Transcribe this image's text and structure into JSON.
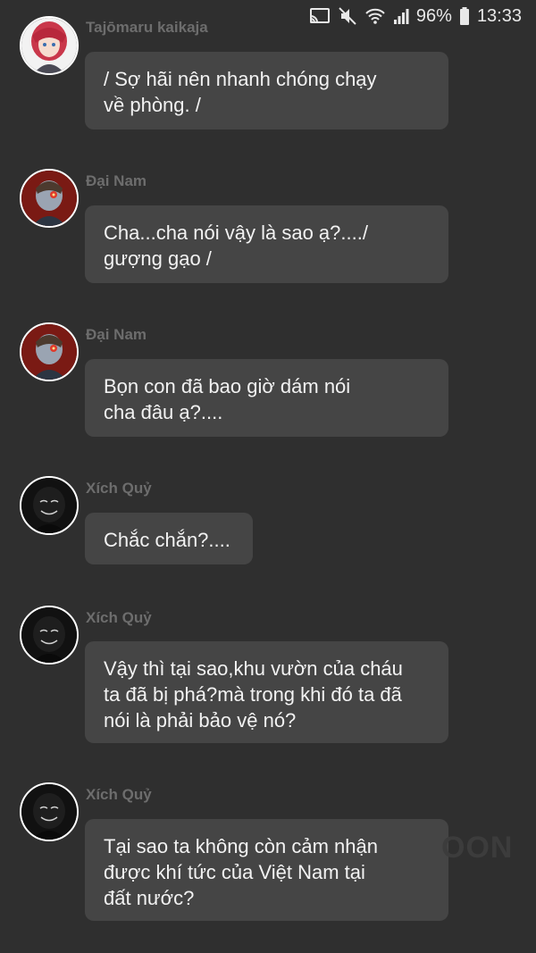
{
  "status_bar": {
    "battery_percent": "96%",
    "time": "13:33"
  },
  "watermark": "OON",
  "messages": [
    {
      "sender": "Tajōmaru kaikaja",
      "text": "/ Sợ hãi nên nhanh chóng chạy\nvề phòng. /",
      "avatar": "tajomaru-avatar"
    },
    {
      "sender": "Đại Nam",
      "text": "Cha...cha nói vậy là sao ạ?..../\ngượng gạo /",
      "avatar": "dai-nam-avatar"
    },
    {
      "sender": "Đại Nam",
      "text": "Bọn con đã bao giờ dám nói\ncha đâu ạ?....",
      "avatar": "dai-nam-avatar"
    },
    {
      "sender": "Xích Quỷ",
      "text": "Chắc chắn?....",
      "avatar": "xich-quy-avatar"
    },
    {
      "sender": "Xích Quỷ",
      "text": "Vậy thì tại sao,khu vườn của cháu\nta đã bị phá?mà trong khi đó ta đã\nnói là phải bảo vệ nó?",
      "avatar": "xich-quy-avatar"
    },
    {
      "sender": "Xích Quỷ",
      "text": "Tại sao ta không còn cảm nhận\nđược khí tức của Việt Nam tại\nđất nước?",
      "avatar": "xich-quy-avatar"
    }
  ]
}
